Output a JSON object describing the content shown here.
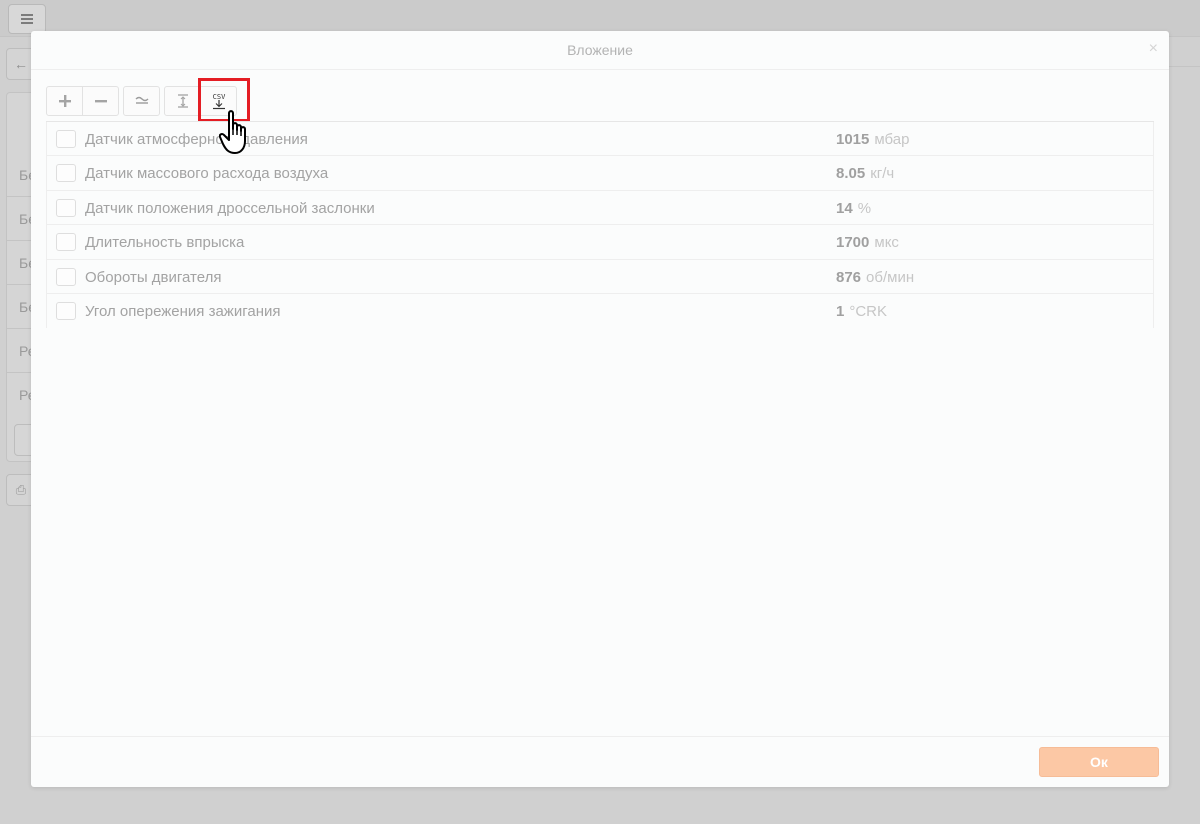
{
  "dialog": {
    "title": "Вложение",
    "close_glyph": "×",
    "ok_label": "Ок"
  },
  "toolbar": {
    "buttons": [
      {
        "name": "add",
        "icon": "plus-icon",
        "glyph": "+"
      },
      {
        "name": "remove",
        "icon": "minus-icon",
        "glyph": "−"
      },
      {
        "name": "approx",
        "icon": "approx-icon",
        "glyph": "≂"
      },
      {
        "name": "align",
        "icon": "text-height-icon",
        "glyph": "Ⅰ"
      },
      {
        "name": "csv-export",
        "icon": "csv-download-icon",
        "glyph": "CSV"
      }
    ]
  },
  "sensors": [
    {
      "label": "Датчик атмосферного давления",
      "value": "1015",
      "unit": "мбар"
    },
    {
      "label": "Датчик массового расхода воздуха",
      "value": "8.05",
      "unit": "кг/ч"
    },
    {
      "label": "Датчик положения дроссельной заслонки",
      "value": "14",
      "unit": "%"
    },
    {
      "label": "Длительность впрыска",
      "value": "1700",
      "unit": "мкс"
    },
    {
      "label": "Обороты двигателя",
      "value": "876",
      "unit": "об/мин"
    },
    {
      "label": "Угол опережения зажигания",
      "value": "1",
      "unit": "°CRK"
    }
  ],
  "background": {
    "rows": [
      "Бе",
      "Бе",
      "Бе",
      "Бе",
      "Ре",
      "Ре"
    ],
    "back_glyph": "←",
    "print_glyph": "⎙",
    "menu_icon": "hamburger-menu-icon"
  },
  "colors": {
    "ok_button": "#fcc8a5",
    "highlight": "#e41d24"
  }
}
